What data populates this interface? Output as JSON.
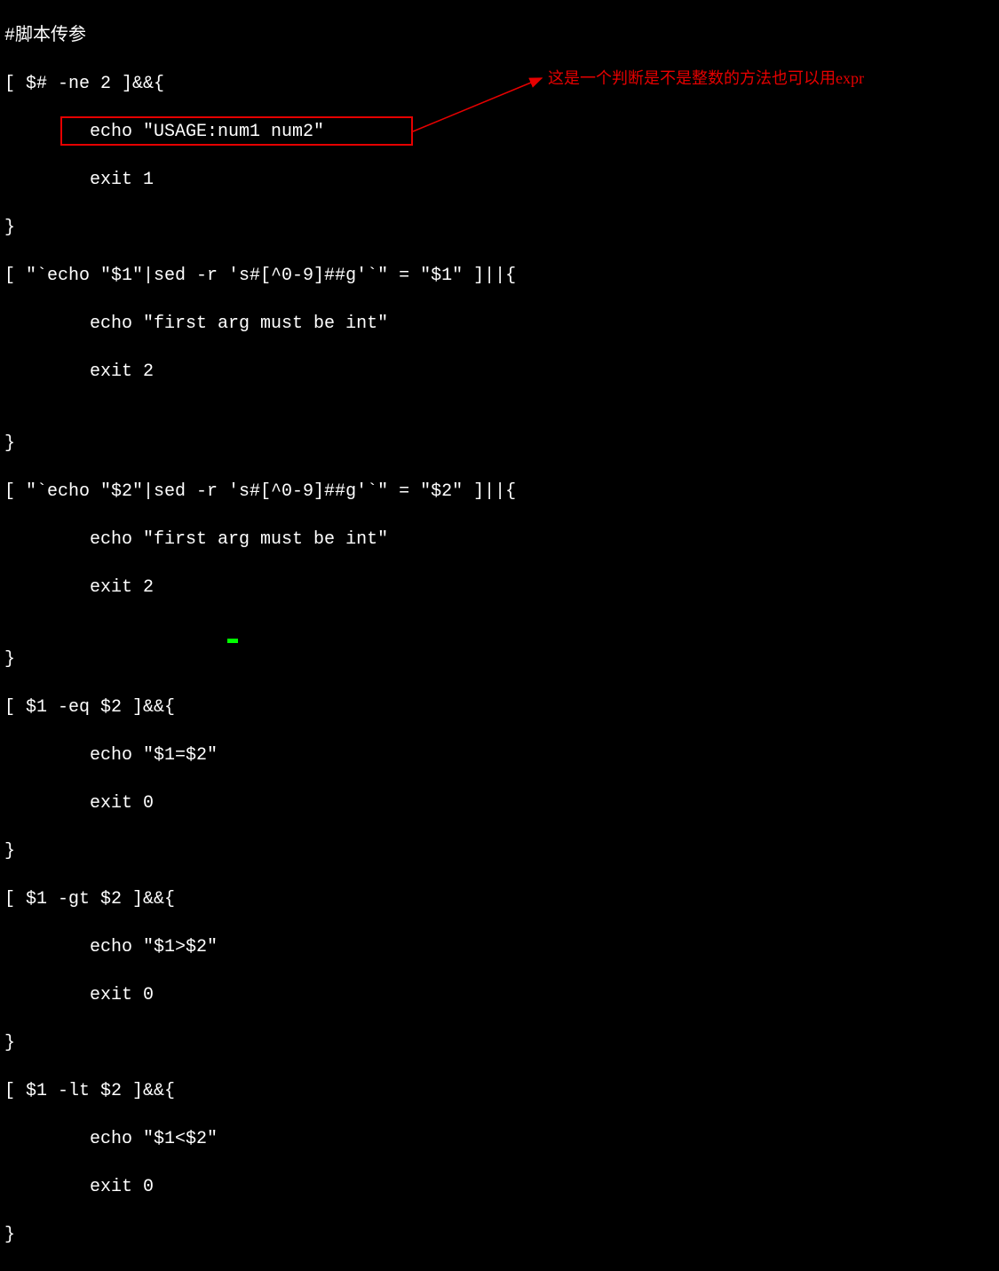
{
  "annotation_text": "这是一个判断是不是整数的方法也可以用expr",
  "code": {
    "l01": "#脚本传参",
    "l02": "[ $# -ne 2 ]&&{",
    "l03": "        echo \"USAGE:num1 num2\"",
    "l04": "        exit 1",
    "l05": "}",
    "l06": "[ \"`echo \"$1\"|sed -r 's#[^0-9]##g'`\" = \"$1\" ]||{",
    "l07": "        echo \"first arg must be int\"",
    "l08": "        exit 2",
    "l09": "",
    "l10": "}",
    "l11": "[ \"`echo \"$2\"|sed -r 's#[^0-9]##g'`\" = \"$2\" ]||{",
    "l12": "        echo \"first arg must be int\"",
    "l13": "        exit 2",
    "l14": "",
    "l15": "}",
    "l16": "[ $1 -eq $2 ]&&{",
    "l17": "        echo \"$1=$2\"",
    "l18": "        exit 0",
    "l19": "}",
    "l20": "[ $1 -gt $2 ]&&{",
    "l21": "        echo \"$1>$2\"",
    "l22": "        exit 0",
    "l23": "}",
    "l24": "[ $1 -lt $2 ]&&{",
    "l25": "        echo \"$1<$2\"",
    "l26": "        exit 0",
    "l27": "}"
  }
}
